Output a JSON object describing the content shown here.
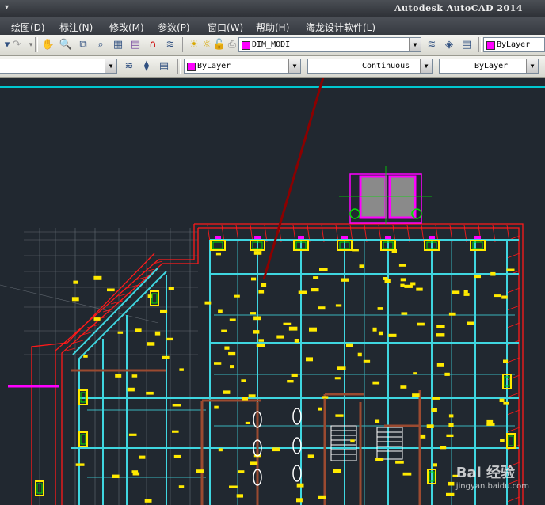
{
  "title_bar": {
    "app_title": "Autodesk AutoCAD 2014",
    "quick_access": "▾"
  },
  "menu": [
    {
      "label": "绘图(D)"
    },
    {
      "label": "标注(N)"
    },
    {
      "label": "修改(M)"
    },
    {
      "label": "参数(P)"
    },
    {
      "label": "窗口(W)"
    },
    {
      "label": "帮助(H)"
    },
    {
      "label": "海龙设计软件(L)"
    }
  ],
  "toolbar1": {
    "layer_value": "DIM_MODI",
    "color_value": "ByLayer"
  },
  "toolbar2": {
    "color_value": "ByLayer",
    "linetype_value": "Continuous",
    "lineweight_value": "ByLayer"
  },
  "colors": {
    "canvas_bg": "#212830",
    "layer_swatch": "#ff00ff",
    "annotation_arrow": "#8b0000"
  },
  "watermark": {
    "brand": "Bai 经验",
    "url": "jingyan.baidu.com"
  }
}
